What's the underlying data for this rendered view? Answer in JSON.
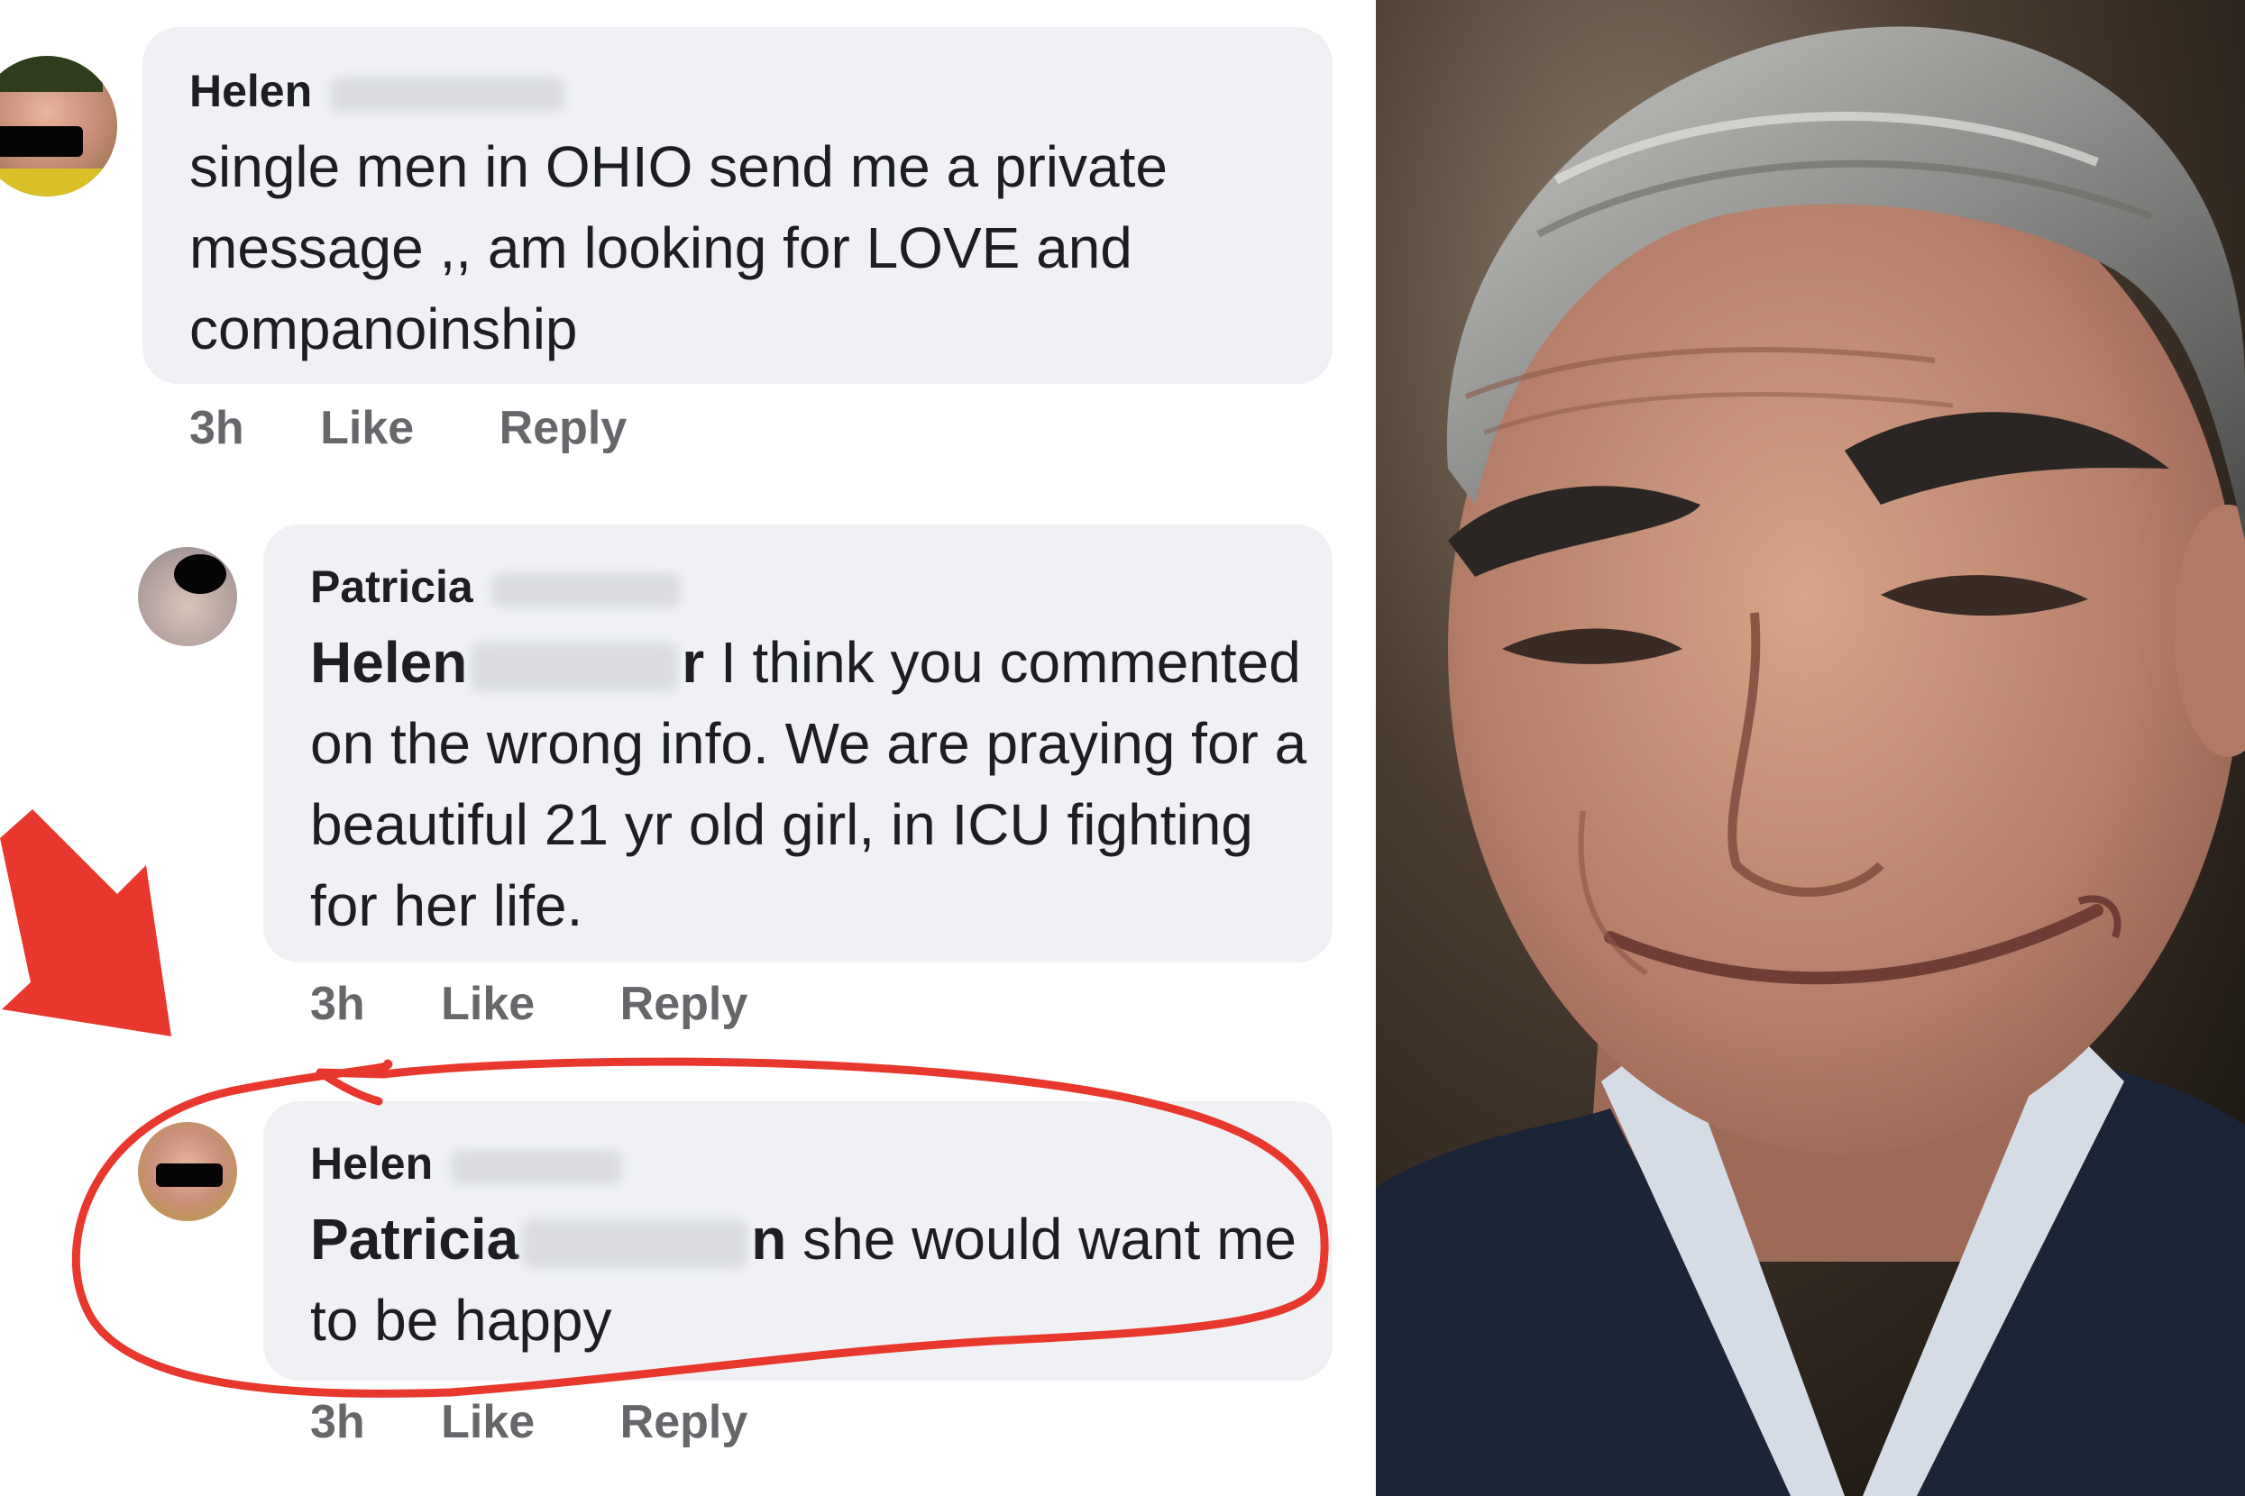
{
  "comments": [
    {
      "author": "Helen",
      "text": "single  men in OHIO send me  a private message ,, am looking for LOVE  and companoinship",
      "time": "3h",
      "like": "Like",
      "reply": "Reply"
    },
    {
      "author": "Patricia",
      "mention": "Helen",
      "mention_tail": "r",
      "text": "I think you commented on the wrong info. We are praying for a beautiful 21 yr old girl, in ICU fighting for her life.",
      "time": "3h",
      "like": "Like",
      "reply": "Reply"
    },
    {
      "author": "Helen",
      "mention": "Patricia",
      "mention_tail": "n",
      "text": "she   would want me to be happy",
      "time": "3h",
      "like": "Like",
      "reply": "Reply"
    }
  ],
  "annotation": {
    "color": "#e8372c",
    "highlighted_comment": 3
  },
  "photo": {
    "subject": "smirking-man-photo",
    "background": "#2c231d",
    "jacket": "#1c2438",
    "shirt": "#d6dce6"
  }
}
